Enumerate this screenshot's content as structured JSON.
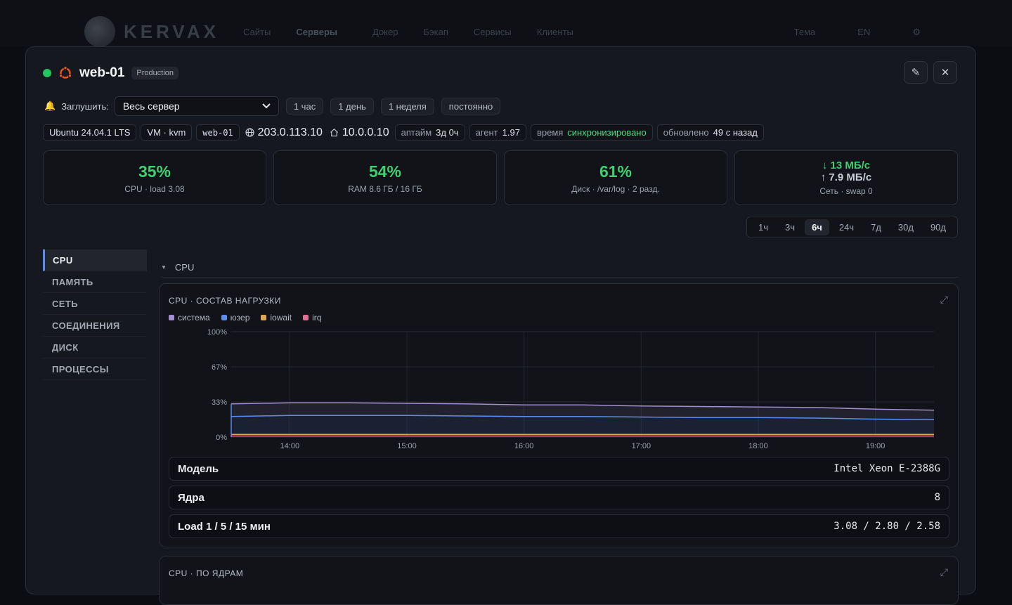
{
  "topnav": {
    "brand": "KERVAX",
    "items": [
      "Сайты",
      "Серверы",
      "Докер",
      "Бэкап",
      "Сервисы",
      "Клиенты"
    ],
    "right": [
      "Тема",
      "EN",
      "⚙"
    ]
  },
  "server": {
    "name": "web-01",
    "env": "Production",
    "status_color": "#22c55e"
  },
  "mute": {
    "label": "Заглушить:",
    "selected": "Весь сервер",
    "options": [
      "1 час",
      "1 день",
      "1 неделя",
      "постоянно"
    ]
  },
  "info": {
    "os": "Ubuntu 24.04.1 LTS",
    "virt": "VM · kvm",
    "hostname": "web-01",
    "public_ip": "203.0.113.10",
    "private_ip": "10.0.0.10",
    "uptime_label": "аптайм",
    "uptime_value": "3д 0ч",
    "agent_label": "агент",
    "agent_value": "1.97",
    "time_label": "время",
    "time_value": "синхронизировано",
    "updated_label": "обновлено",
    "updated_value": "49 с назад"
  },
  "stats": {
    "cpu_value": "35%",
    "cpu_sub": "CPU · load 3.08",
    "ram_value": "54%",
    "ram_sub": "RAM 8.6 ГБ / 16 ГБ",
    "disk_value": "61%",
    "disk_sub": "Диск · /var/log · 2 разд.",
    "net_down": "↓ 13 МБ/с",
    "net_up": "↑ 7.9 МБ/с",
    "net_sub": "Сеть · swap 0"
  },
  "ranges": [
    "1ч",
    "3ч",
    "6ч",
    "24ч",
    "7д",
    "30д",
    "90д"
  ],
  "active_range": "6ч",
  "sidebar": [
    "CPU",
    "ПАМЯТЬ",
    "СЕТЬ",
    "СОЕДИНЕНИЯ",
    "ДИСК",
    "ПРОЦЕССЫ"
  ],
  "section_title": "CPU",
  "card_title": "CPU · СОСТАВ НАГРУЗКИ",
  "card2_title": "CPU · ПО ЯДРАМ",
  "details": {
    "model_label": "Модель",
    "model_value": "Intel Xeon E-2388G",
    "cores_label": "Ядра",
    "cores_value": "8",
    "load_label": "Load 1 / 5 / 15 мин",
    "load_value": "3.08 / 2.80 / 2.58"
  },
  "chart_data": {
    "type": "area",
    "x": [
      "13:30",
      "14:00",
      "14:30",
      "15:00",
      "15:30",
      "16:00",
      "16:30",
      "17:00",
      "17:30",
      "18:00",
      "18:30",
      "19:00",
      "19:30"
    ],
    "xticks": [
      "14:00",
      "15:00",
      "16:00",
      "17:00",
      "18:00",
      "19:00"
    ],
    "yticks": [
      "0%",
      "33%",
      "67%",
      "100%"
    ],
    "ylim": [
      0,
      100
    ],
    "grid": true,
    "legend_position": "top-left",
    "series": [
      {
        "name": "система",
        "color": "#a48ed1",
        "values": [
          12,
          12,
          12,
          11.5,
          11.5,
          11,
          11,
          10.5,
          10.5,
          10,
          10,
          9.5,
          9
        ]
      },
      {
        "name": "юзер",
        "color": "#5b8def",
        "values": [
          17,
          18,
          18,
          18,
          17.5,
          17,
          17,
          16.5,
          16,
          16,
          15.5,
          14.5,
          14
        ]
      },
      {
        "name": "iowait",
        "color": "#e1a94f",
        "values": [
          1.5,
          1.5,
          1.5,
          1.5,
          1.5,
          1.5,
          1.5,
          1.5,
          1.5,
          1.5,
          1.5,
          1.5,
          1.5
        ]
      },
      {
        "name": "irq",
        "color": "#e0708f",
        "values": [
          1,
          1,
          1,
          1,
          1,
          1,
          1,
          1,
          1,
          1,
          1,
          1,
          1
        ]
      }
    ]
  }
}
